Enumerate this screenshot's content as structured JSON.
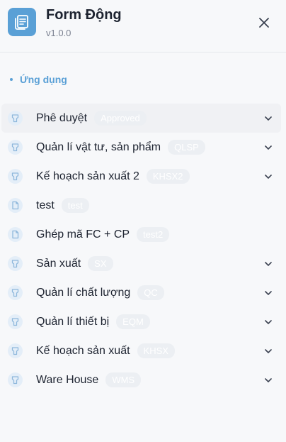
{
  "header": {
    "title": "Form Động",
    "version": "v1.0.0",
    "logo_icon": "document-stack-icon",
    "close_icon": "close-icon"
  },
  "section": {
    "label": "Ứng dụng"
  },
  "menu": [
    {
      "label": "Phê duyệt",
      "badge": "Approved",
      "icon": "tooth-icon",
      "expandable": true,
      "active": true
    },
    {
      "label": "Quản lí vật tư, sản phẩm",
      "badge": "QLSP",
      "icon": "tooth-icon",
      "expandable": true
    },
    {
      "label": "Kế hoạch sản xuất 2",
      "badge": "KHSX2",
      "icon": "tooth-icon",
      "expandable": true
    },
    {
      "label": "test",
      "badge": "test",
      "icon": "file-icon",
      "expandable": false
    },
    {
      "label": "Ghép mã FC + CP",
      "badge": "test2",
      "icon": "file-icon",
      "expandable": false
    },
    {
      "label": "Sản xuất",
      "badge": "SX",
      "icon": "tooth-icon",
      "expandable": true
    },
    {
      "label": "Quản lí chất lượng",
      "badge": "QC",
      "icon": "tooth-icon",
      "expandable": true
    },
    {
      "label": "Quản lí thiết bị",
      "badge": "EQM",
      "icon": "tooth-icon",
      "expandable": true
    },
    {
      "label": "Kế hoạch sản xuất",
      "badge": "KHSX",
      "icon": "tooth-icon",
      "expandable": true
    },
    {
      "label": "Ware House",
      "badge": "WMS",
      "icon": "tooth-icon",
      "expandable": true
    }
  ],
  "colors": {
    "accent": "#5aa0d6",
    "icon_bg": "#e4eef8",
    "badge_bg": "#eceff3"
  }
}
